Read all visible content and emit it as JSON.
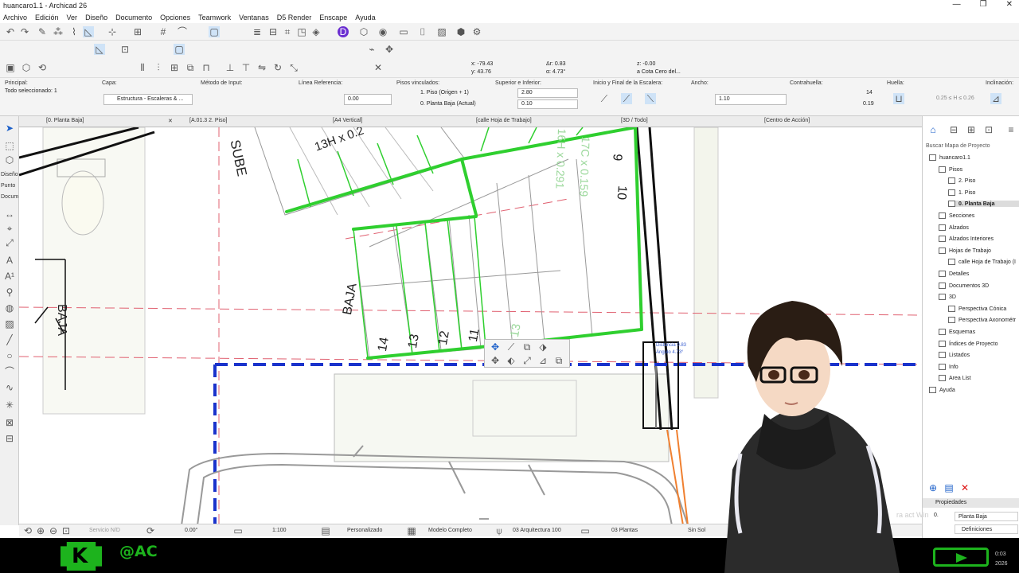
{
  "window": {
    "title": "huancaro1.1 - Archicad 26",
    "minimize": "—",
    "maximize": "❐",
    "close": "✕"
  },
  "menu": [
    "Archivo",
    "Edición",
    "Ver",
    "Diseño",
    "Documento",
    "Opciones",
    "Teamwork",
    "Ventanas",
    "D5 Render",
    "Enscape",
    "Ayuda"
  ],
  "coords": {
    "x": "x: -79.43",
    "y": "y: 43.76",
    "dr": "Δr: 0.83",
    "da": "α: 4.73°",
    "z": "z: -0.00",
    "ref": "a Cota Cero del..."
  },
  "infobox": {
    "principal_label": "Principal:",
    "selected": "Todo seleccionado: 1",
    "capa_label": "Capa:",
    "capa_value": "Estructura - Escaleras & ...",
    "metodo_label": "Método de Input:",
    "linea_label": "Línea Referencia:",
    "linea_value": "0.00",
    "pisos_label": "Pisos vinculados:",
    "piso_top": "1. Piso (Origen + 1)",
    "piso_bottom": "0. Planta Baja (Actual)",
    "sup_label": "Superior e Inferior:",
    "sup_top": "2.80",
    "sup_bottom": "0.10",
    "inicio_label": "Inicio y Final de la Escalera:",
    "ancho_label": "Ancho:",
    "ancho_value": "1.10",
    "contra_label": "Contrahuella:",
    "contra_top": "14",
    "contra_bottom": "0.19",
    "huella_label": "Huella:",
    "huella_value": "0.25 ≤ H ≤ 0.26",
    "incl_label": "Inclinación:"
  },
  "tabs": [
    "[0. Planta Baja]",
    "[A.01.3 2. Piso]",
    "[A4 Vertical]",
    "[calle Hoja de Trabajo]",
    "[3D / Todo]",
    "[Centro de Acción]"
  ],
  "toolbox_labels": [
    "Diseño",
    "Punto",
    "Docum"
  ],
  "navigator": {
    "search": "Buscar Mapa de Proyecto",
    "items": [
      {
        "label": "huancaro1.1",
        "indent": 0
      },
      {
        "label": "Pisos",
        "indent": 1
      },
      {
        "label": "2. Piso",
        "indent": 2
      },
      {
        "label": "1. Piso",
        "indent": 2
      },
      {
        "label": "0. Planta Baja",
        "indent": 2,
        "selected": true
      },
      {
        "label": "Secciones",
        "indent": 1
      },
      {
        "label": "Alzados",
        "indent": 1
      },
      {
        "label": "Alzados Interiores",
        "indent": 1
      },
      {
        "label": "Hojas de Trabajo",
        "indent": 1
      },
      {
        "label": "calle Hoja de Trabajo (I",
        "indent": 2
      },
      {
        "label": "Detalles",
        "indent": 1
      },
      {
        "label": "Documentos 3D",
        "indent": 1
      },
      {
        "label": "3D",
        "indent": 1
      },
      {
        "label": "Perspectiva Cónica",
        "indent": 2
      },
      {
        "label": "Perspectiva Axonométr",
        "indent": 2
      },
      {
        "label": "Esquemas",
        "indent": 1
      },
      {
        "label": "Índices de Proyecto",
        "indent": 1
      },
      {
        "label": "Listados",
        "indent": 1
      },
      {
        "label": "Info",
        "indent": 1
      },
      {
        "label": "Area List",
        "indent": 1
      },
      {
        "label": "Ayuda",
        "indent": 0
      }
    ],
    "props_header": "Propiedades",
    "props_value": "Planta Baja",
    "props_prefix": "0.",
    "definitions": "Definiciones"
  },
  "drawing": {
    "subE": "SUBE",
    "riser_label": "13H x 0.2",
    "baja": "BAJA",
    "baja_left": "BAJA",
    "steps_bottom": [
      "14",
      "13",
      "12",
      "11"
    ],
    "step_13_faint": "13",
    "steps_right": [
      "9",
      "10"
    ],
    "faint_dims": [
      "17C x 0.159",
      "16H x 0.291"
    ],
    "tooltip_dist": "Distancia 0.83",
    "tooltip_ang": "Ángulo 4.73°"
  },
  "status": {
    "scale_n": "Servicio N/D",
    "angle": "0.00°",
    "scale": "1:100",
    "pen": "Personalizado",
    "model": "Modelo Completo",
    "layer": "03 Arquitectura 100",
    "dims": "03 Plantas",
    "extra": "Sin Sol"
  },
  "overlay": {
    "handle": "@AC",
    "logo_letter": "K",
    "clock_time": "0:03",
    "clock_year": "2026",
    "watermark": "ra act Win"
  },
  "colors": {
    "accent_green": "#1db31d",
    "stair_green": "#2fcf2f",
    "blue_dash": "#1a33cc",
    "red_dash": "#e06070"
  }
}
